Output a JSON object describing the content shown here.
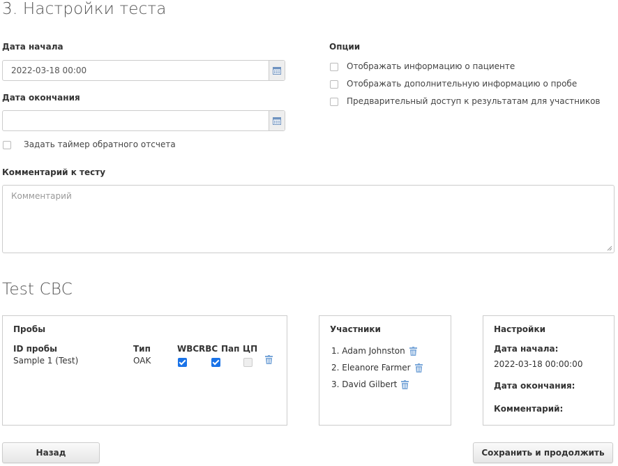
{
  "section_title": "3. Настройки теста",
  "start_date": {
    "label": "Дата начала",
    "value": "2022-03-18 00:00"
  },
  "end_date": {
    "label": "Дата окончания",
    "value": ""
  },
  "timer": {
    "label": "Задать таймер обратного отсчета",
    "checked": false
  },
  "options": {
    "title": "Опции",
    "items": [
      {
        "label": "Отображать информацию о пациенте",
        "checked": false
      },
      {
        "label": "Отображать дополнительную информацию о пробе",
        "checked": false
      },
      {
        "label": "Предварительный доступ к результатам для участников",
        "checked": false
      }
    ]
  },
  "comment": {
    "label": "Комментарий к тесту",
    "placeholder": "Комментарий"
  },
  "test_title": "Test CBC",
  "samples": {
    "title": "Пробы",
    "headers": {
      "id": "ID пробы",
      "type": "Тип",
      "wbc": "WBC",
      "rbc": "RBC",
      "pap": "Пап",
      "cp": "ЦП"
    },
    "rows": [
      {
        "id": "Sample 1 (Test)",
        "type": "OAK",
        "wbc": true,
        "rbc": true,
        "pap": null,
        "cp": false
      }
    ]
  },
  "participants": {
    "title": "Участники",
    "items": [
      "1. Adam Johnston",
      "2. Eleanore Farmer",
      "3. David Gilbert"
    ]
  },
  "settings": {
    "title": "Настройки",
    "start_label": "Дата начала:",
    "start_value": "2022-03-18 00:00:00",
    "end_label": "Дата окончания:",
    "comment_label": "Комментарий:"
  },
  "buttons": {
    "back": "Назад",
    "save": "Сохранить и продолжить"
  },
  "colors": {
    "accent": "#1a73e8",
    "icon": "#7aa7d9"
  }
}
